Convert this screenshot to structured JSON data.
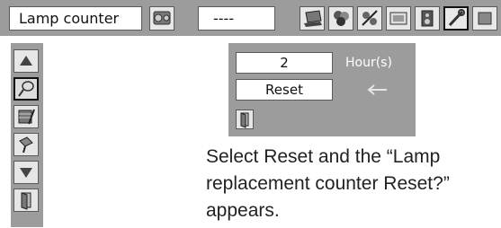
{
  "header": {
    "title": "Lamp counter",
    "value": "----",
    "icons": [
      "projector-settings-icon",
      "laptop-icon",
      "color-palette-icon",
      "image-adjust-icon",
      "screen-icon",
      "sound-icon",
      "tools-icon",
      "extra-icon"
    ]
  },
  "sidebar": {
    "items": [
      {
        "icon": "up-arrow-icon"
      },
      {
        "icon": "lamp-icon"
      },
      {
        "icon": "filter-icon"
      },
      {
        "icon": "tools-icon"
      },
      {
        "icon": "down-arrow-icon"
      },
      {
        "icon": "exit-icon"
      }
    ]
  },
  "panel": {
    "hours_value": "2",
    "hours_label": "Hour(s)",
    "reset_label": "Reset"
  },
  "description": {
    "line1": "Select Reset and the “Lamp",
    "line2": "replacement counter Reset?”",
    "line3": "appears."
  }
}
